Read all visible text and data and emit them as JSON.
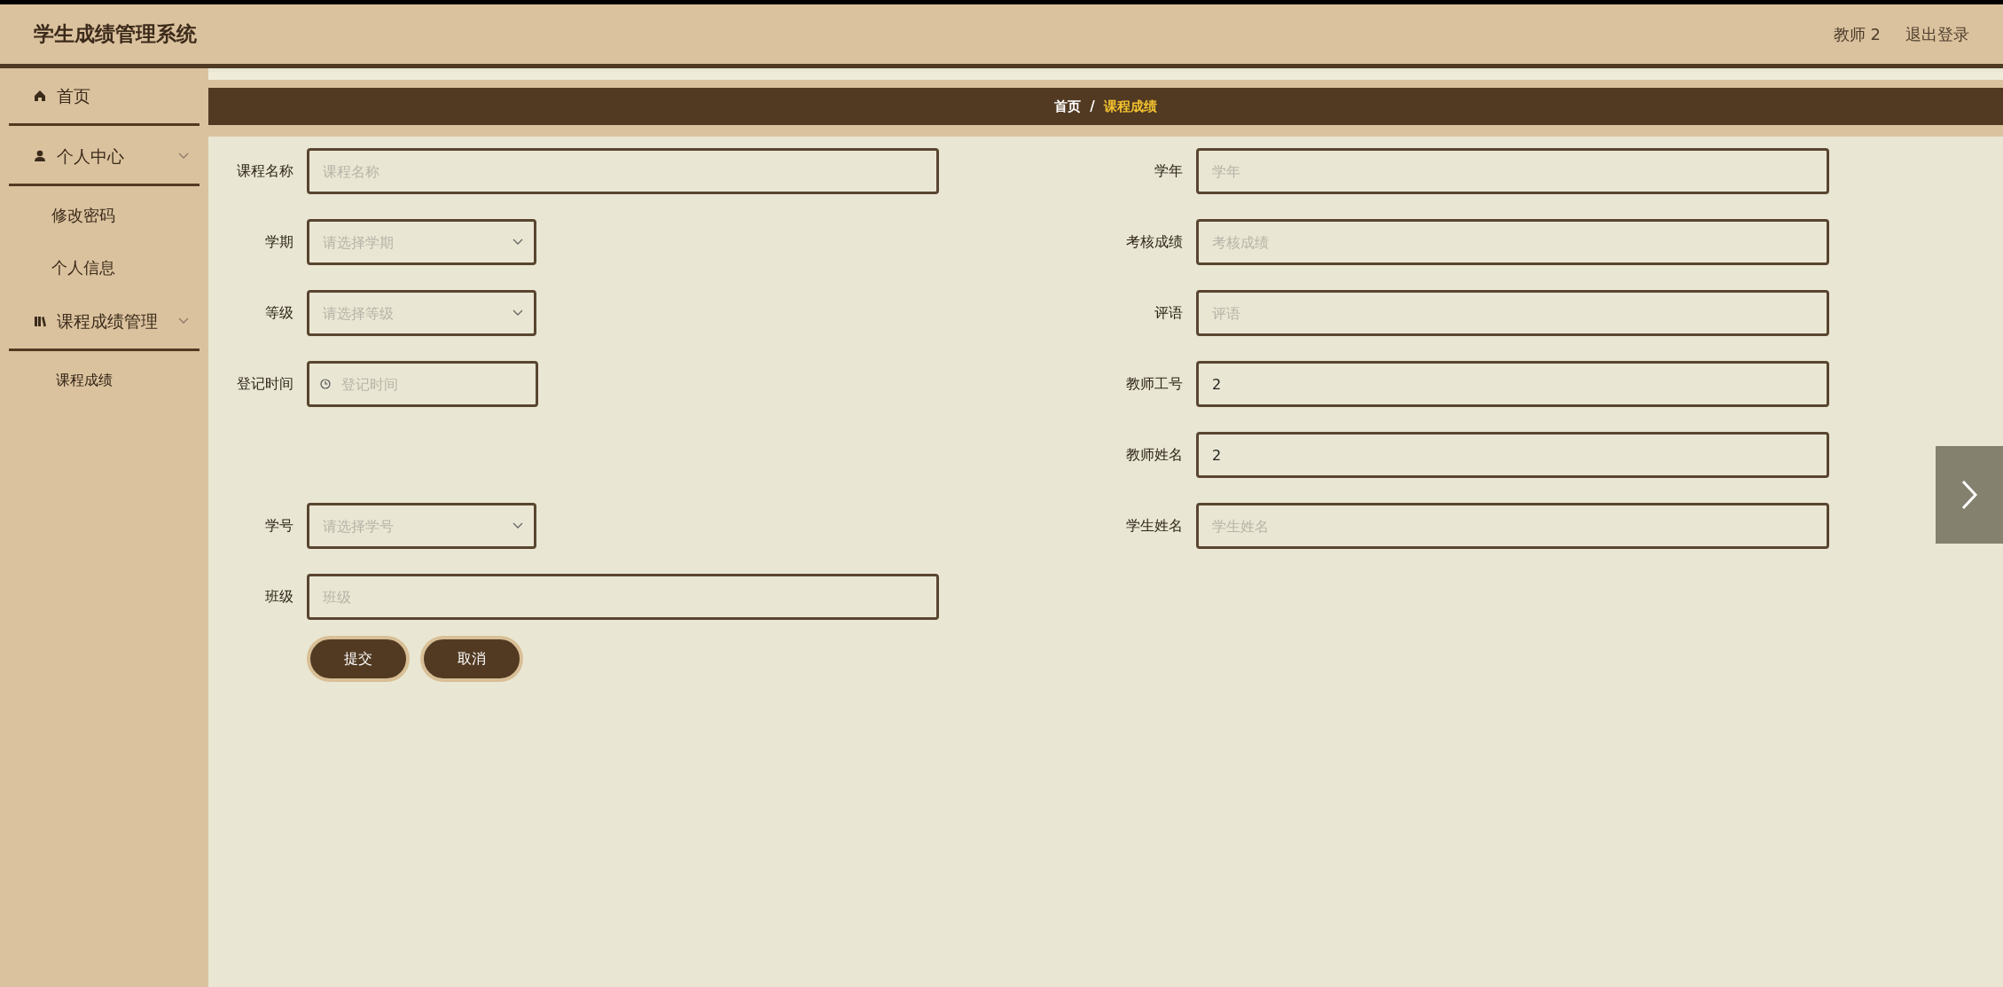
{
  "header": {
    "title": "学生成绩管理系统",
    "user": "教师 2",
    "logout": "退出登录"
  },
  "sidebar": {
    "items": [
      {
        "label": "首页",
        "selected": false
      },
      {
        "label": "个人中心",
        "expanded": true,
        "children": [
          {
            "label": "修改密码",
            "selected": false
          },
          {
            "label": "个人信息",
            "selected": false
          }
        ]
      },
      {
        "label": "课程成绩管理",
        "expanded": true,
        "children": [
          {
            "label": "课程成绩",
            "selected": true
          }
        ]
      }
    ]
  },
  "breadcrumb": {
    "separator": "/",
    "items": [
      {
        "label": "首页",
        "current": false
      },
      {
        "label": "课程成绩",
        "current": true
      }
    ]
  },
  "form": {
    "rows": [
      {
        "left": {
          "label": "课程名称",
          "kind": "text",
          "placeholder": "课程名称"
        },
        "right": {
          "label": "学年",
          "kind": "text",
          "placeholder": "学年"
        }
      },
      {
        "left": {
          "label": "学期",
          "kind": "select",
          "placeholder": "请选择学期"
        },
        "right": {
          "label": "考核成绩",
          "kind": "text",
          "placeholder": "考核成绩"
        }
      },
      {
        "left": {
          "label": "等级",
          "kind": "select",
          "placeholder": "请选择等级"
        },
        "right": {
          "label": "评语",
          "kind": "text",
          "placeholder": "评语"
        }
      },
      {
        "left": {
          "label": "登记时间",
          "kind": "date",
          "placeholder": "登记时间"
        },
        "right": {
          "label": "教师工号",
          "kind": "text",
          "value": "2"
        }
      },
      {
        "right": {
          "label": "教师姓名",
          "kind": "text",
          "value": "2"
        }
      },
      {
        "left": {
          "label": "学号",
          "kind": "select",
          "placeholder": "请选择学号"
        },
        "right": {
          "label": "学生姓名",
          "kind": "text",
          "placeholder": "学生姓名"
        }
      },
      {
        "left": {
          "label": "班级",
          "kind": "text",
          "placeholder": "班级"
        }
      }
    ],
    "buttons": [
      "提交",
      "取消"
    ]
  }
}
